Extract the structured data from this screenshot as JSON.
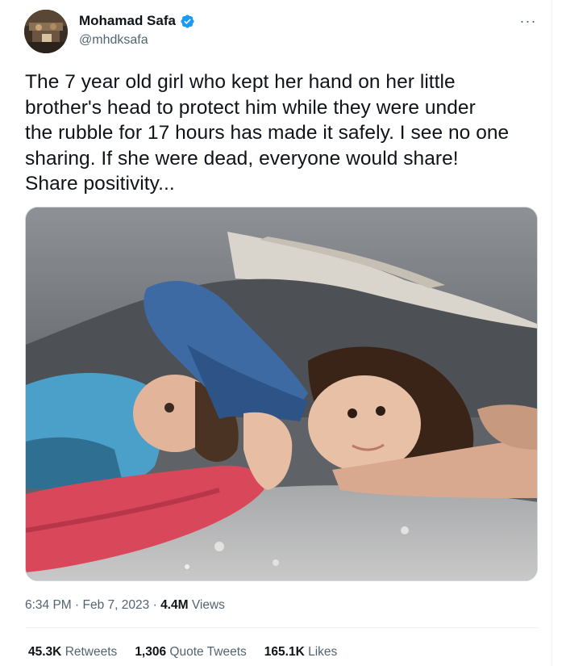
{
  "author": {
    "display_name": "Mohamad Safa",
    "handle": "@mhdksafa",
    "avatar_icon": "profile-avatar",
    "verified_icon": "verified-badge-icon",
    "verified_color": "#1d9bf0"
  },
  "more_menu": {
    "label": "···",
    "icon": "more-options-icon"
  },
  "tweet": {
    "text": "The 7 year old girl who kept her hand on her little\nbrother's head to protect him while they were under\nthe rubble for 17 hours has made it safely. I see no one\nsharing. If she were dead, everyone would share!\nShare positivity..."
  },
  "media": {
    "icon": "photo-children-under-rubble"
  },
  "meta": {
    "time": "6:34 PM",
    "separator": "·",
    "date": "Feb 7, 2023",
    "views_count": "4.4M",
    "views_label": "Views"
  },
  "stats": {
    "retweets": {
      "count": "45.3K",
      "label": "Retweets"
    },
    "quotes": {
      "count": "1,306",
      "label": "Quote Tweets"
    },
    "likes": {
      "count": "165.1K",
      "label": "Likes"
    }
  },
  "colors": {
    "text_primary": "#0f1419",
    "text_secondary": "#536471",
    "border": "#eff3f4"
  }
}
